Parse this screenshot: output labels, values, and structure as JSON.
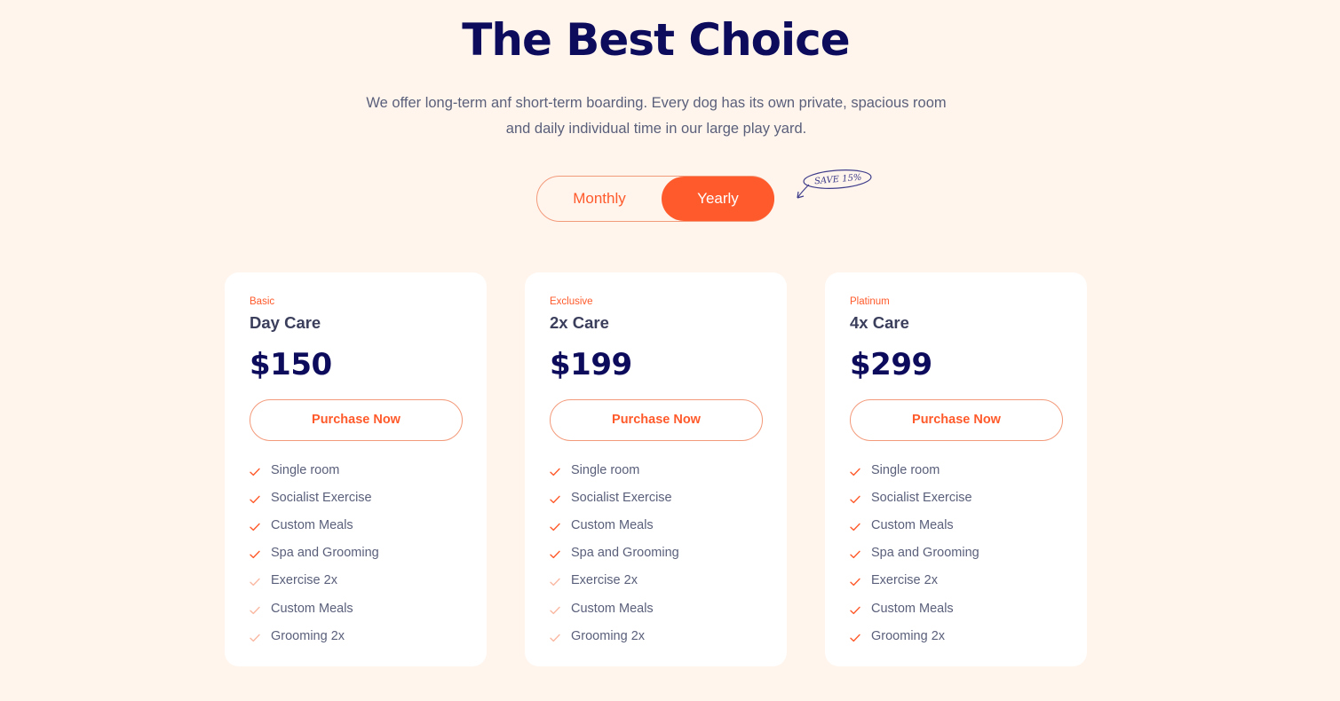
{
  "header": {
    "title": "The Best Choice",
    "subtitle": "We offer long-term anf short-term boarding. Every dog has its own private, spacious room and daily individual time in our large play yard."
  },
  "billing_toggle": {
    "monthly_label": "Monthly",
    "yearly_label": "Yearly",
    "selected": "Yearly",
    "save_note": "SAVE 15%"
  },
  "colors": {
    "accent": "#ff5a2b",
    "heading": "#0c0b5c",
    "background": "#fff5ed",
    "card": "#ffffff",
    "check_active": "#ff5a2b",
    "check_inactive": "#f9b8a2"
  },
  "plans": [
    {
      "tier": "Basic",
      "name": "Day Care",
      "price": "$150",
      "cta": "Purchase Now",
      "features": [
        {
          "label": "Single room",
          "included": true
        },
        {
          "label": "Socialist Exercise",
          "included": true
        },
        {
          "label": "Custom Meals",
          "included": true
        },
        {
          "label": "Spa and Grooming",
          "included": true
        },
        {
          "label": "Exercise 2x",
          "included": false
        },
        {
          "label": "Custom Meals",
          "included": false
        },
        {
          "label": "Grooming 2x",
          "included": false
        }
      ]
    },
    {
      "tier": "Exclusive",
      "name": "2x Care",
      "price": "$199",
      "cta": "Purchase Now",
      "features": [
        {
          "label": "Single room",
          "included": true
        },
        {
          "label": "Socialist Exercise",
          "included": true
        },
        {
          "label": "Custom Meals",
          "included": true
        },
        {
          "label": "Spa and Grooming",
          "included": true
        },
        {
          "label": "Exercise 2x",
          "included": false
        },
        {
          "label": "Custom Meals",
          "included": false
        },
        {
          "label": "Grooming 2x",
          "included": false
        }
      ]
    },
    {
      "tier": "Platinum",
      "name": "4x Care",
      "price": "$299",
      "cta": "Purchase Now",
      "features": [
        {
          "label": "Single room",
          "included": true
        },
        {
          "label": "Socialist Exercise",
          "included": true
        },
        {
          "label": "Custom Meals",
          "included": true
        },
        {
          "label": "Spa and Grooming",
          "included": true
        },
        {
          "label": "Exercise 2x",
          "included": true
        },
        {
          "label": "Custom Meals",
          "included": true
        },
        {
          "label": "Grooming 2x",
          "included": true
        }
      ]
    }
  ]
}
